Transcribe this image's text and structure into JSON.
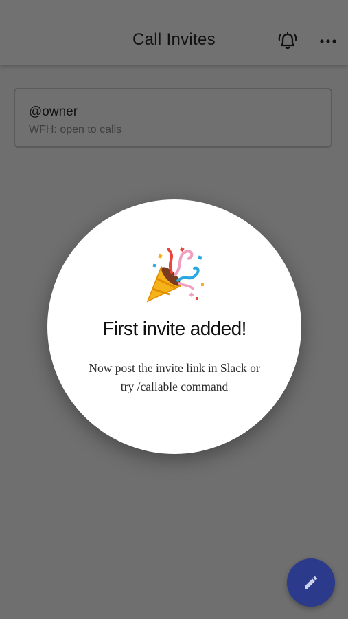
{
  "header": {
    "title": "Call Invites",
    "bell_icon": "bell-ring-icon",
    "more_icon": "more-horizontal-icon"
  },
  "status_card": {
    "handle": "@owner",
    "status": "WFH: open to calls"
  },
  "dialog": {
    "icon": "party-popper-icon",
    "title": "First invite added!",
    "message_line1": "Now post the invite link in Slack or",
    "message_line2": "try /callable command"
  },
  "fab": {
    "icon": "pencil-icon",
    "color": "#2b3a8a"
  }
}
